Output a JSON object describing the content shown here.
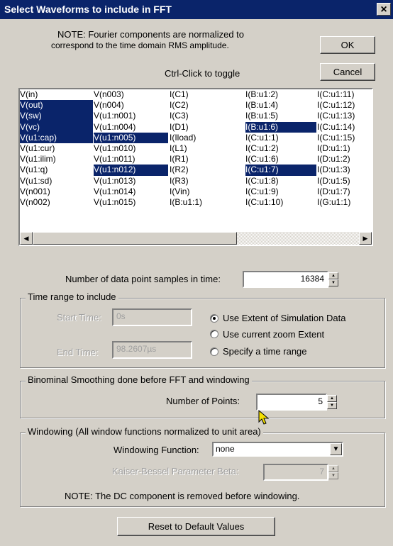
{
  "window": {
    "title": "Select Waveforms to include in FFT",
    "close_glyph": "×"
  },
  "note_top": {
    "line1": "NOTE:  Fourier components are normalized to",
    "line2": "correspond to the time domain RMS amplitude.",
    "toggle_hint": "Ctrl-Click to toggle"
  },
  "buttons": {
    "ok": "OK",
    "cancel": "Cancel",
    "reset": "Reset to Default Values"
  },
  "waveforms": {
    "columns": [
      [
        {
          "label": "V(in)",
          "selected": false
        },
        {
          "label": "V(out)",
          "selected": true
        },
        {
          "label": "V(sw)",
          "selected": true
        },
        {
          "label": "V(vc)",
          "selected": true
        },
        {
          "label": "V(u1:cap)",
          "selected": true
        },
        {
          "label": "V(u1:cur)",
          "selected": false
        },
        {
          "label": "V(u1:ilim)",
          "selected": false
        },
        {
          "label": "V(u1:q)",
          "selected": false
        },
        {
          "label": "V(u1:sd)",
          "selected": false
        },
        {
          "label": "V(n001)",
          "selected": false
        },
        {
          "label": "V(n002)",
          "selected": false
        }
      ],
      [
        {
          "label": "V(n003)",
          "selected": false
        },
        {
          "label": "V(n004)",
          "selected": false
        },
        {
          "label": "V(u1:n001)",
          "selected": false
        },
        {
          "label": "V(u1:n004)",
          "selected": false
        },
        {
          "label": "V(u1:n005)",
          "selected": true
        },
        {
          "label": "V(u1:n010)",
          "selected": false
        },
        {
          "label": "V(u1:n011)",
          "selected": false
        },
        {
          "label": "V(u1:n012)",
          "selected": true
        },
        {
          "label": "V(u1:n013)",
          "selected": false
        },
        {
          "label": "V(u1:n014)",
          "selected": false
        },
        {
          "label": "V(u1:n015)",
          "selected": false
        }
      ],
      [
        {
          "label": "I(C1)",
          "selected": false
        },
        {
          "label": "I(C2)",
          "selected": false
        },
        {
          "label": "I(C3)",
          "selected": false
        },
        {
          "label": "I(D1)",
          "selected": false
        },
        {
          "label": "I(Iload)",
          "selected": false
        },
        {
          "label": "I(L1)",
          "selected": false
        },
        {
          "label": "I(R1)",
          "selected": false
        },
        {
          "label": "I(R2)",
          "selected": false
        },
        {
          "label": "I(R3)",
          "selected": false
        },
        {
          "label": "I(Vin)",
          "selected": false
        },
        {
          "label": "I(B:u1:1)",
          "selected": false
        }
      ],
      [
        {
          "label": "I(B:u1:2)",
          "selected": false
        },
        {
          "label": "I(B:u1:4)",
          "selected": false
        },
        {
          "label": "I(B:u1:5)",
          "selected": false
        },
        {
          "label": "I(B:u1:6)",
          "selected": true
        },
        {
          "label": "I(C:u1:1)",
          "selected": false
        },
        {
          "label": "I(C:u1:2)",
          "selected": false
        },
        {
          "label": "I(C:u1:6)",
          "selected": false
        },
        {
          "label": "I(C:u1:7)",
          "selected": true
        },
        {
          "label": "I(C:u1:8)",
          "selected": false
        },
        {
          "label": "I(C:u1:9)",
          "selected": false
        },
        {
          "label": "I(C:u1:10)",
          "selected": false
        }
      ],
      [
        {
          "label": "I(C:u1:11)",
          "selected": false
        },
        {
          "label": "I(C:u1:12)",
          "selected": false
        },
        {
          "label": "I(C:u1:13)",
          "selected": false
        },
        {
          "label": "I(C:u1:14)",
          "selected": false
        },
        {
          "label": "I(C:u1:15)",
          "selected": false
        },
        {
          "label": "I(D:u1:1)",
          "selected": false
        },
        {
          "label": "I(D:u1:2)",
          "selected": false
        },
        {
          "label": "I(D:u1:3)",
          "selected": false
        },
        {
          "label": "I(D:u1:5)",
          "selected": false
        },
        {
          "label": "I(D:u1:7)",
          "selected": false
        },
        {
          "label": "I(G:u1:1)",
          "selected": false
        }
      ]
    ],
    "scroll_left_glyph": "◀",
    "scroll_right_glyph": "▶"
  },
  "samples": {
    "label": "Number of data point samples in time:",
    "value": "16384"
  },
  "time_range": {
    "legend": "Time range to include",
    "start_label": "Start Time:",
    "start_value": "0s",
    "end_label": "End Time:",
    "end_value": "98.2607µs",
    "options": [
      "Use Extent of Simulation Data",
      "Use current zoom Extent",
      "Specify a time range"
    ],
    "selected_index": 0
  },
  "smoothing": {
    "legend": "Binominal Smoothing done before FFT and windowing",
    "points_label": "Number of Points:",
    "points_value": "5"
  },
  "windowing": {
    "legend": "Windowing  (All window functions normalized to unit area)",
    "function_label": "Windowing Function:",
    "function_value": "none",
    "beta_label": "Kaiser-Bessel Parameter Beta:",
    "beta_value": "7",
    "note": "NOTE:  The DC component is removed before windowing."
  },
  "icons": {
    "spin_up": "▲",
    "spin_down": "▼",
    "dropdown": "▼"
  }
}
